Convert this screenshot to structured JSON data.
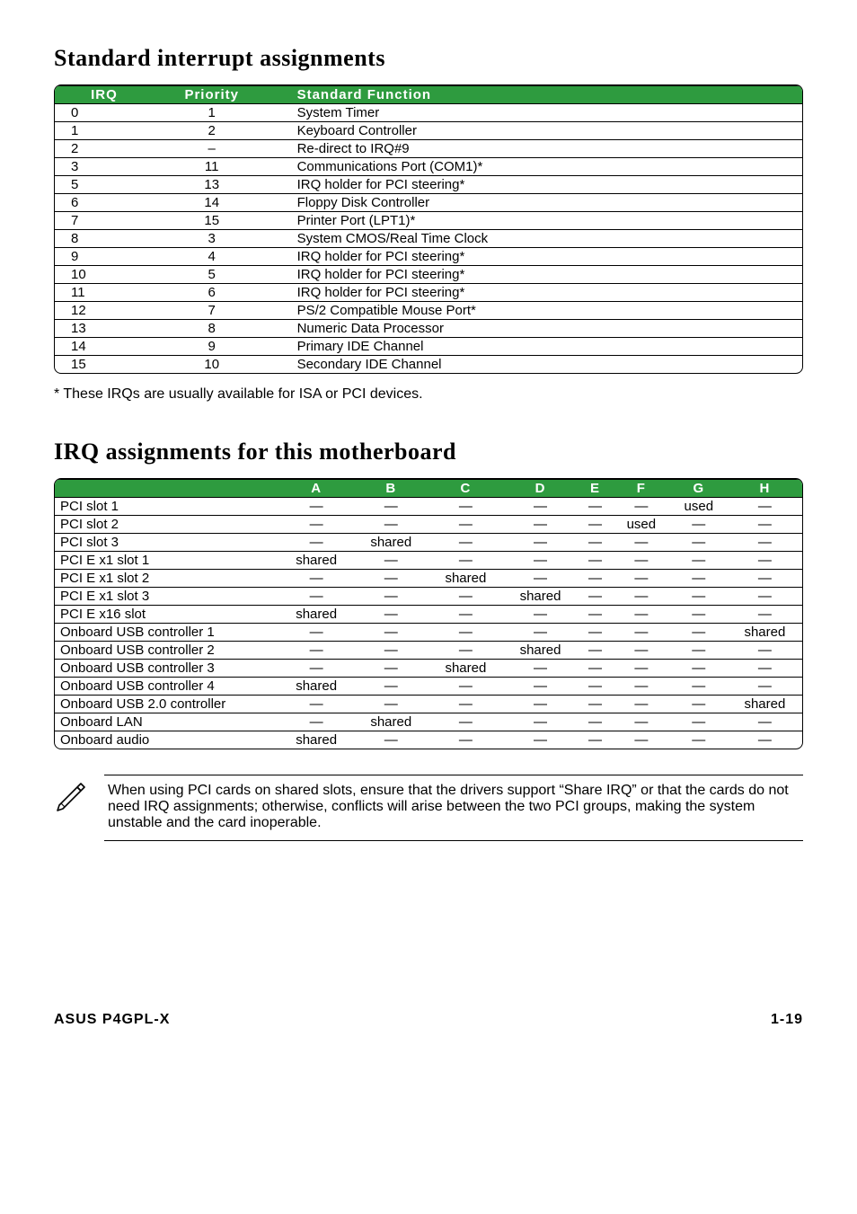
{
  "section1_title": "Standard interrupt assignments",
  "table1": {
    "headers": {
      "irq": "IRQ",
      "priority": "Priority",
      "func": "Standard Function"
    },
    "rows": [
      {
        "irq": "0",
        "pri": "1",
        "func": "System Timer"
      },
      {
        "irq": "1",
        "pri": "2",
        "func": "Keyboard Controller"
      },
      {
        "irq": "2",
        "pri": "–",
        "func": "Re-direct to IRQ#9"
      },
      {
        "irq": "3",
        "pri": "11",
        "func": "Communications Port (COM1)*"
      },
      {
        "irq": "5",
        "pri": "13",
        "func": "IRQ holder for PCI steering*"
      },
      {
        "irq": "6",
        "pri": "14",
        "func": "Floppy Disk Controller"
      },
      {
        "irq": "7",
        "pri": "15",
        "func": "Printer Port (LPT1)*"
      },
      {
        "irq": "8",
        "pri": "3",
        "func": "System CMOS/Real Time Clock"
      },
      {
        "irq": "9",
        "pri": "4",
        "func": "IRQ holder for PCI steering*"
      },
      {
        "irq": "10",
        "pri": "5",
        "func": "IRQ holder for PCI steering*"
      },
      {
        "irq": "11",
        "pri": "6",
        "func": "IRQ holder for PCI steering*"
      },
      {
        "irq": "12",
        "pri": "7",
        "func": "PS/2 Compatible Mouse Port*"
      },
      {
        "irq": "13",
        "pri": "8",
        "func": "Numeric Data Processor"
      },
      {
        "irq": "14",
        "pri": "9",
        "func": "Primary IDE Channel"
      },
      {
        "irq": "15",
        "pri": "10",
        "func": "Secondary IDE Channel"
      }
    ]
  },
  "table1_footnote": "* These IRQs are usually available for ISA or PCI devices.",
  "section2_title": "IRQ assignments for this motherboard",
  "table2": {
    "headers": [
      "",
      "A",
      "B",
      "C",
      "D",
      "E",
      "F",
      "G",
      "H"
    ],
    "rows": [
      {
        "label": "PCI slot 1",
        "cells": [
          "—",
          "—",
          "—",
          "—",
          "—",
          "—",
          "used",
          "—"
        ]
      },
      {
        "label": "PCI slot 2",
        "cells": [
          "—",
          "—",
          "—",
          "—",
          "—",
          "used",
          "—",
          "—"
        ]
      },
      {
        "label": "PCI slot 3",
        "cells": [
          "—",
          "shared",
          "—",
          "—",
          "—",
          "—",
          "—",
          "—"
        ]
      },
      {
        "label": "PCI E x1 slot 1",
        "cells": [
          "shared",
          "—",
          "—",
          "—",
          "—",
          "—",
          "—",
          "—"
        ]
      },
      {
        "label": "PCI E x1 slot 2",
        "cells": [
          "—",
          "—",
          "shared",
          "—",
          "—",
          "—",
          "—",
          "—"
        ]
      },
      {
        "label": "PCI E x1 slot 3",
        "cells": [
          "—",
          "—",
          "—",
          "shared",
          "—",
          "—",
          "—",
          "—"
        ]
      },
      {
        "label": "PCI E x16 slot",
        "cells": [
          "shared",
          "—",
          "—",
          "—",
          "—",
          "—",
          "—",
          "—"
        ]
      },
      {
        "label": "Onboard USB controller 1",
        "cells": [
          "—",
          "—",
          "—",
          "—",
          "—",
          "—",
          "—",
          "shared"
        ]
      },
      {
        "label": "Onboard USB controller 2",
        "cells": [
          "—",
          "—",
          "—",
          "shared",
          "—",
          "—",
          "—",
          "—"
        ]
      },
      {
        "label": "Onboard USB controller 3",
        "cells": [
          "—",
          "—",
          "shared",
          "—",
          "—",
          "—",
          "—",
          "—"
        ]
      },
      {
        "label": "Onboard USB controller 4",
        "cells": [
          "shared",
          "—",
          "—",
          "—",
          "—",
          "—",
          "—",
          "—"
        ]
      },
      {
        "label": "Onboard USB 2.0 controller",
        "cells": [
          "—",
          "—",
          "—",
          "—",
          "—",
          "—",
          "—",
          "shared"
        ]
      },
      {
        "label": "Onboard LAN",
        "cells": [
          "—",
          "shared",
          "—",
          "—",
          "—",
          "—",
          "—",
          "—"
        ]
      },
      {
        "label": "Onboard audio",
        "cells": [
          "shared",
          "—",
          "—",
          "—",
          "—",
          "—",
          "—",
          "—"
        ]
      }
    ]
  },
  "note_text": "When using PCI cards on shared slots, ensure that the drivers support “Share IRQ” or that the cards do not need IRQ assignments; otherwise, conflicts will arise between the two PCI groups, making the system unstable and the card inoperable.",
  "footer": {
    "left": "ASUS P4GPL-X",
    "right": "1-19"
  }
}
